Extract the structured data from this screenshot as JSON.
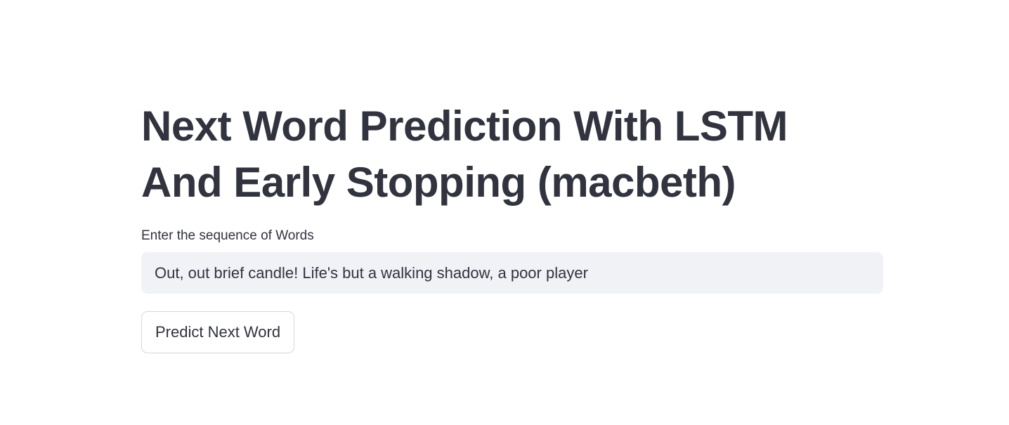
{
  "header": {
    "title": "Next Word Prediction With LSTM And Early Stopping (macbeth)"
  },
  "form": {
    "input_label": "Enter the sequence of Words",
    "input_value": "Out, out brief candle! Life's but a walking shadow, a poor player",
    "button_label": "Predict Next Word"
  },
  "colors": {
    "text": "#31333f",
    "input_background": "#f0f2f6",
    "button_border": "#d6d6d9",
    "page_background": "#ffffff"
  }
}
